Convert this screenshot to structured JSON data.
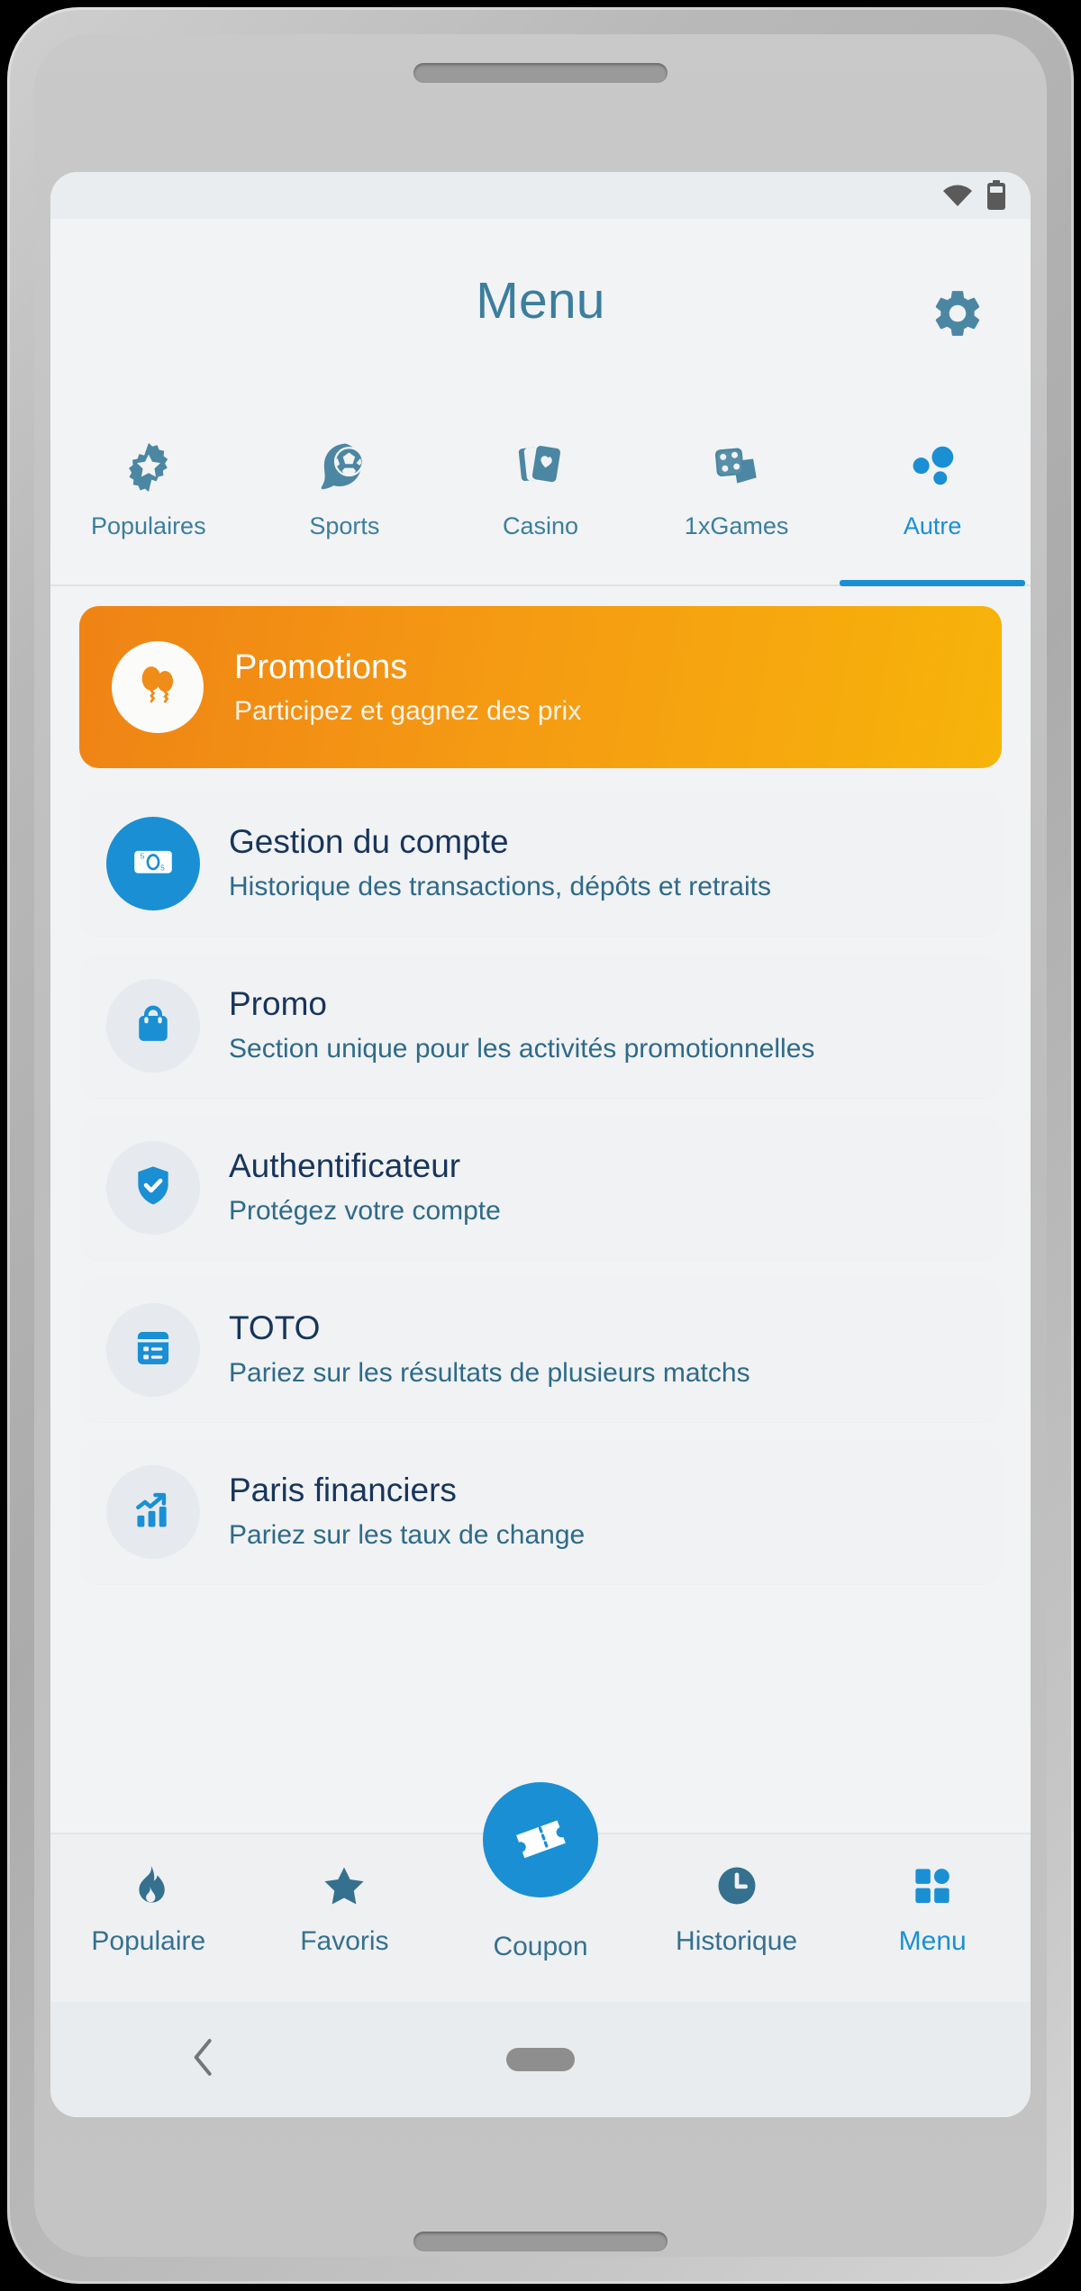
{
  "status_bar": {
    "wifi_icon": "wifi-icon",
    "battery_icon": "battery-icon"
  },
  "header": {
    "title": "Menu",
    "settings_icon": "gear-icon"
  },
  "top_tabs": [
    {
      "label": "Populaires",
      "icon": "badge-star-icon",
      "active": false
    },
    {
      "label": "Sports",
      "icon": "football-chat-icon",
      "active": false
    },
    {
      "label": "Casino",
      "icon": "playing-cards-icon",
      "active": false
    },
    {
      "label": "1xGames",
      "icon": "dice-icon",
      "active": false
    },
    {
      "label": "Autre",
      "icon": "dots-cluster-icon",
      "active": true
    }
  ],
  "promo_banner": {
    "title": "Promotions",
    "subtitle": "Participez et gagnez des prix",
    "icon": "balloons-icon"
  },
  "menu_items": [
    {
      "title": "Gestion du compte",
      "subtitle": "Historique des transactions, dépôts et retraits",
      "icon": "banknote-icon",
      "icon_style": "accent"
    },
    {
      "title": "Promo",
      "subtitle": "Section unique pour les activités promotionnelles",
      "icon": "shopping-bag-icon",
      "icon_style": "muted"
    },
    {
      "title": "Authentificateur",
      "subtitle": "Protégez votre compte",
      "icon": "shield-check-icon",
      "icon_style": "muted"
    },
    {
      "title": "TOTO",
      "subtitle": "Pariez sur les résultats de plusieurs matchs",
      "icon": "list-card-icon",
      "icon_style": "muted"
    },
    {
      "title": "Paris financiers",
      "subtitle": "Pariez sur les taux de change",
      "icon": "chart-growth-icon",
      "icon_style": "muted"
    }
  ],
  "bottom_nav": [
    {
      "label": "Populaire",
      "icon": "flame-icon",
      "active": false
    },
    {
      "label": "Favoris",
      "icon": "star-icon",
      "active": false
    },
    {
      "label": "Coupon",
      "icon": "ticket-icon",
      "active": false
    },
    {
      "label": "Historique",
      "icon": "clock-icon",
      "active": false
    },
    {
      "label": "Menu",
      "icon": "grid-icon",
      "active": true
    }
  ],
  "system_nav": {
    "back_icon": "chevron-left-icon",
    "home_icon": "home-pill-icon"
  },
  "colors": {
    "accent_blue": "#1a8fd4",
    "muted_blue": "#3b7e9e",
    "title_navy": "#17355c",
    "promo_orange": "#f29417",
    "screen_bg": "#f2f3f4"
  }
}
